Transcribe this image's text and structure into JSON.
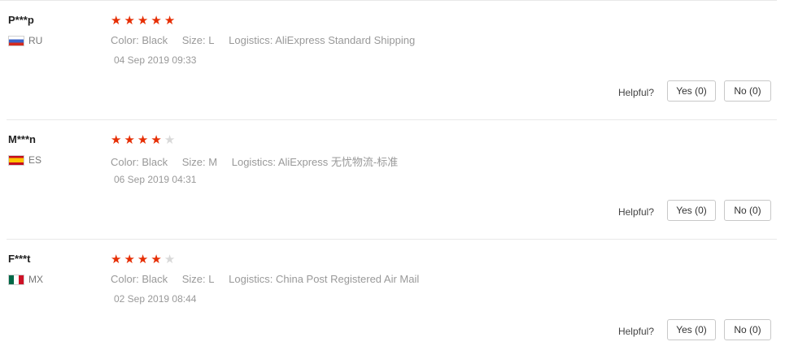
{
  "labels": {
    "color": "Color:",
    "size": "Size:",
    "logistics": "Logistics:",
    "helpful": "Helpful?"
  },
  "colors": {
    "star_filled": "#e62e04",
    "star_empty": "#d9d9d9"
  },
  "reviews": [
    {
      "user": "P***p",
      "country_code": "RU",
      "flag_icon": "russia-flag-icon",
      "rating": 5,
      "color": "Black",
      "size": "L",
      "logistics": "AliExpress Standard Shipping",
      "date": "04 Sep 2019 09:33",
      "yes_label": "Yes (0)",
      "no_label": "No (0)"
    },
    {
      "user": "M***n",
      "country_code": "ES",
      "flag_icon": "spain-flag-icon",
      "rating": 4,
      "color": "Black",
      "size": "M",
      "logistics": "AliExpress 无忧物流-标准",
      "date": "06 Sep 2019 04:31",
      "yes_label": "Yes (0)",
      "no_label": "No (0)"
    },
    {
      "user": "F***t",
      "country_code": "MX",
      "flag_icon": "mexico-flag-icon",
      "rating": 4,
      "color": "Black",
      "size": "L",
      "logistics": "China Post Registered Air Mail",
      "date": "02 Sep 2019 08:44",
      "yes_label": "Yes (0)",
      "no_label": "No (0)"
    }
  ]
}
